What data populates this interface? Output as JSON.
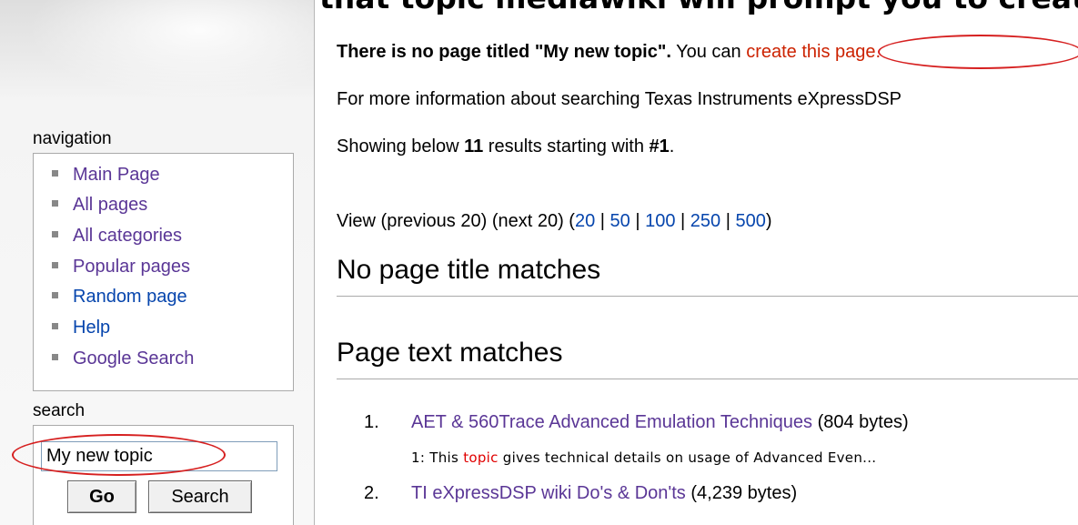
{
  "banner": {
    "text": "ebody has created that topic mediawiki will prompt you to creat"
  },
  "sidebar": {
    "navigation_title": "navigation",
    "nav_items": [
      {
        "label": "Main Page"
      },
      {
        "label": "All pages"
      },
      {
        "label": "All categories"
      },
      {
        "label": "Popular pages"
      },
      {
        "label": "Random page"
      },
      {
        "label": "Help"
      },
      {
        "label": "Google Search"
      }
    ],
    "search_title": "search",
    "search_value": "My new topic",
    "go_label": "Go",
    "search_label": "Search"
  },
  "main": {
    "no_page_bold": "There is no page titled \"My new topic\".",
    "you_can": " You can",
    "create_link": "create this page.",
    "more_info": "For more information about searching Texas Instruments eXpressDSP",
    "showing_prefix": "Showing below ",
    "showing_count": "11",
    "showing_mid": " results starting with ",
    "showing_start": "#1",
    "showing_end": ".",
    "view_prefix": "View (previous 20) (next 20) (",
    "view_options": [
      "20",
      "50",
      "100",
      "250",
      "500"
    ],
    "view_sep": " | ",
    "view_suffix": ")",
    "heading_title_matches": "No page title matches",
    "heading_text_matches": "Page text matches",
    "results": [
      {
        "number": "1.",
        "title": "AET & 560Trace Advanced Emulation Techniques",
        "size": " (804 bytes)",
        "snippet_prefix": "1: This ",
        "snippet_highlight": "topic",
        "snippet_suffix": " gives technical details on usage of Advanced Even..."
      },
      {
        "number": "2.",
        "title": "TI eXpressDSP wiki Do's & Don'ts",
        "size": " (4,239 bytes)"
      }
    ]
  },
  "colors": {
    "link_visited": "#5a3696",
    "link_blue": "#0645ad",
    "link_red": "#cc2200",
    "annotation_oval": "#d62020"
  }
}
